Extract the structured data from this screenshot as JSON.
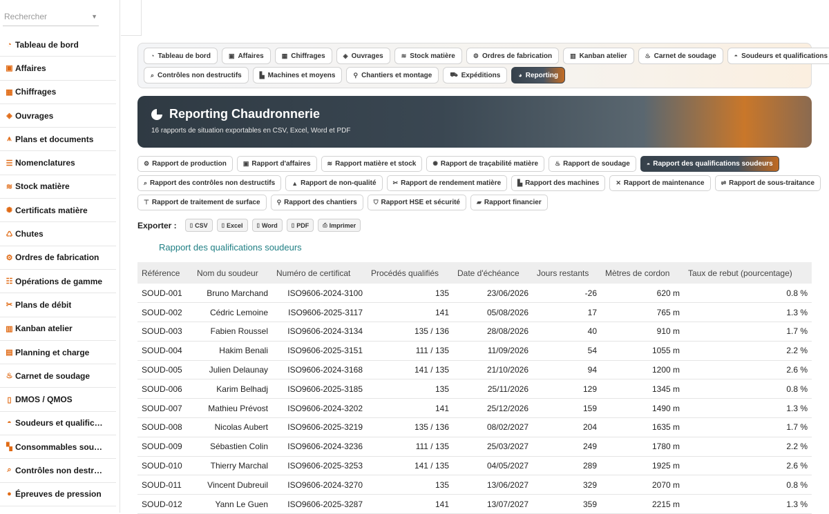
{
  "sidebar": {
    "search_placeholder": "Rechercher",
    "items": [
      {
        "label": "Tableau de bord",
        "icon": "gauge"
      },
      {
        "label": "Affaires",
        "icon": "briefcase"
      },
      {
        "label": "Chiffrages",
        "icon": "calculator"
      },
      {
        "label": "Ouvrages",
        "icon": "cube"
      },
      {
        "label": "Plans et documents",
        "icon": "drafting-compass"
      },
      {
        "label": "Nomenclatures",
        "icon": "list"
      },
      {
        "label": "Stock matière",
        "icon": "layers"
      },
      {
        "label": "Certificats matière",
        "icon": "certificate"
      },
      {
        "label": "Chutes",
        "icon": "recycle"
      },
      {
        "label": "Ordres de fabrication",
        "icon": "gears"
      },
      {
        "label": "Opérations de gamme",
        "icon": "list-check"
      },
      {
        "label": "Plans de débit",
        "icon": "scissors"
      },
      {
        "label": "Kanban atelier",
        "icon": "table-columns"
      },
      {
        "label": "Planning et charge",
        "icon": "calendar"
      },
      {
        "label": "Carnet de soudage",
        "icon": "fire"
      },
      {
        "label": "DMOS / QMOS",
        "icon": "file"
      },
      {
        "label": "Soudeurs et qualific…",
        "icon": "helmet"
      },
      {
        "label": "Consommables sou…",
        "icon": "boxes"
      },
      {
        "label": "Contrôles non destr…",
        "icon": "magnifier"
      },
      {
        "label": "Épreuves de pression",
        "icon": "droplet"
      }
    ]
  },
  "nav": {
    "row1": [
      {
        "label": "Tableau de bord",
        "icon": "gauge"
      },
      {
        "label": "Affaires",
        "icon": "briefcase"
      },
      {
        "label": "Chiffrages",
        "icon": "calculator"
      },
      {
        "label": "Ouvrages",
        "icon": "cube"
      },
      {
        "label": "Stock matière",
        "icon": "layers"
      },
      {
        "label": "Ordres de fabrication",
        "icon": "gears"
      },
      {
        "label": "Kanban atelier",
        "icon": "table-columns"
      },
      {
        "label": "Carnet de soudage",
        "icon": "fire"
      },
      {
        "label": "Soudeurs et qualifications",
        "icon": "helmet"
      }
    ],
    "row2": [
      {
        "label": "Contrôles non destructifs",
        "icon": "magnifier"
      },
      {
        "label": "Machines et moyens",
        "icon": "industry"
      },
      {
        "label": "Chantiers et montage",
        "icon": "location-pin"
      },
      {
        "label": "Expéditions",
        "icon": "truck"
      },
      {
        "label": "Reporting",
        "icon": "pie-chart",
        "active": true
      }
    ]
  },
  "banner": {
    "title": "Reporting Chaudronnerie",
    "subtitle": "16 rapports de situation exportables en CSV, Excel, Word et PDF"
  },
  "reports": {
    "row1": [
      {
        "label": "Rapport de production",
        "icon": "gears"
      },
      {
        "label": "Rapport d'affaires",
        "icon": "briefcase"
      },
      {
        "label": "Rapport matière et stock",
        "icon": "layers"
      },
      {
        "label": "Rapport de traçabilité matière",
        "icon": "certificate"
      },
      {
        "label": "Rapport de soudage",
        "icon": "fire"
      },
      {
        "label": "Rapport des qualifications soudeurs",
        "icon": "helmet",
        "active": true
      }
    ],
    "row2": [
      {
        "label": "Rapport des contrôles non destructifs",
        "icon": "magnifier"
      },
      {
        "label": "Rapport de non-qualité",
        "icon": "warning"
      },
      {
        "label": "Rapport de rendement matière",
        "icon": "scissors"
      },
      {
        "label": "Rapport des machines",
        "icon": "industry"
      },
      {
        "label": "Rapport de maintenance",
        "icon": "wrench"
      },
      {
        "label": "Rapport de sous-traitance",
        "icon": "handshake"
      }
    ],
    "row3": [
      {
        "label": "Rapport de traitement de surface",
        "icon": "paint-roller"
      },
      {
        "label": "Rapport des chantiers",
        "icon": "location-pin"
      },
      {
        "label": "Rapport HSE et sécurité",
        "icon": "shield"
      },
      {
        "label": "Rapport financier",
        "icon": "money"
      }
    ]
  },
  "export": {
    "label": "Exporter :",
    "buttons": [
      {
        "label": "CSV",
        "icon": "file"
      },
      {
        "label": "Excel",
        "icon": "file"
      },
      {
        "label": "Word",
        "icon": "file"
      },
      {
        "label": "PDF",
        "icon": "file"
      },
      {
        "label": "Imprimer",
        "icon": "printer"
      }
    ]
  },
  "report": {
    "title": "Rapport des qualifications soudeurs",
    "columns": [
      "Référence",
      "Nom du soudeur",
      "Numéro de certificat",
      "Procédés qualifiés",
      "Date d'échéance",
      "Jours restants",
      "Mètres de cordon",
      "Taux de rebut (pourcentage)"
    ],
    "rows": [
      [
        "SOUD-001",
        "Bruno Marchand",
        "ISO9606-2024-3100",
        "135",
        "23/06/2026",
        "-26",
        "620 m",
        "0.8 %"
      ],
      [
        "SOUD-002",
        "Cédric Lemoine",
        "ISO9606-2025-3117",
        "141",
        "05/08/2026",
        "17",
        "765 m",
        "1.3 %"
      ],
      [
        "SOUD-003",
        "Fabien Roussel",
        "ISO9606-2024-3134",
        "135 / 136",
        "28/08/2026",
        "40",
        "910 m",
        "1.7 %"
      ],
      [
        "SOUD-004",
        "Hakim Benali",
        "ISO9606-2025-3151",
        "111 / 135",
        "11/09/2026",
        "54",
        "1055 m",
        "2.2 %"
      ],
      [
        "SOUD-005",
        "Julien Delaunay",
        "ISO9606-2024-3168",
        "141 / 135",
        "21/10/2026",
        "94",
        "1200 m",
        "2.6 %"
      ],
      [
        "SOUD-006",
        "Karim Belhadj",
        "ISO9606-2025-3185",
        "135",
        "25/11/2026",
        "129",
        "1345 m",
        "0.8 %"
      ],
      [
        "SOUD-007",
        "Mathieu Prévost",
        "ISO9606-2024-3202",
        "141",
        "25/12/2026",
        "159",
        "1490 m",
        "1.3 %"
      ],
      [
        "SOUD-008",
        "Nicolas Aubert",
        "ISO9606-2025-3219",
        "135 / 136",
        "08/02/2027",
        "204",
        "1635 m",
        "1.7 %"
      ],
      [
        "SOUD-009",
        "Sébastien Colin",
        "ISO9606-2024-3236",
        "111 / 135",
        "25/03/2027",
        "249",
        "1780 m",
        "2.2 %"
      ],
      [
        "SOUD-010",
        "Thierry Marchal",
        "ISO9606-2025-3253",
        "141 / 135",
        "04/05/2027",
        "289",
        "1925 m",
        "2.6 %"
      ],
      [
        "SOUD-011",
        "Vincent Dubreuil",
        "ISO9606-2024-3270",
        "135",
        "13/06/2027",
        "329",
        "2070 m",
        "0.8 %"
      ],
      [
        "SOUD-012",
        "Yann Le Guen",
        "ISO9606-2025-3287",
        "141",
        "13/07/2027",
        "359",
        "2215 m",
        "1.3 %"
      ]
    ]
  },
  "colors": {
    "accent": "#e06a14",
    "dark": "#36414b",
    "link": "#1f7f84"
  }
}
